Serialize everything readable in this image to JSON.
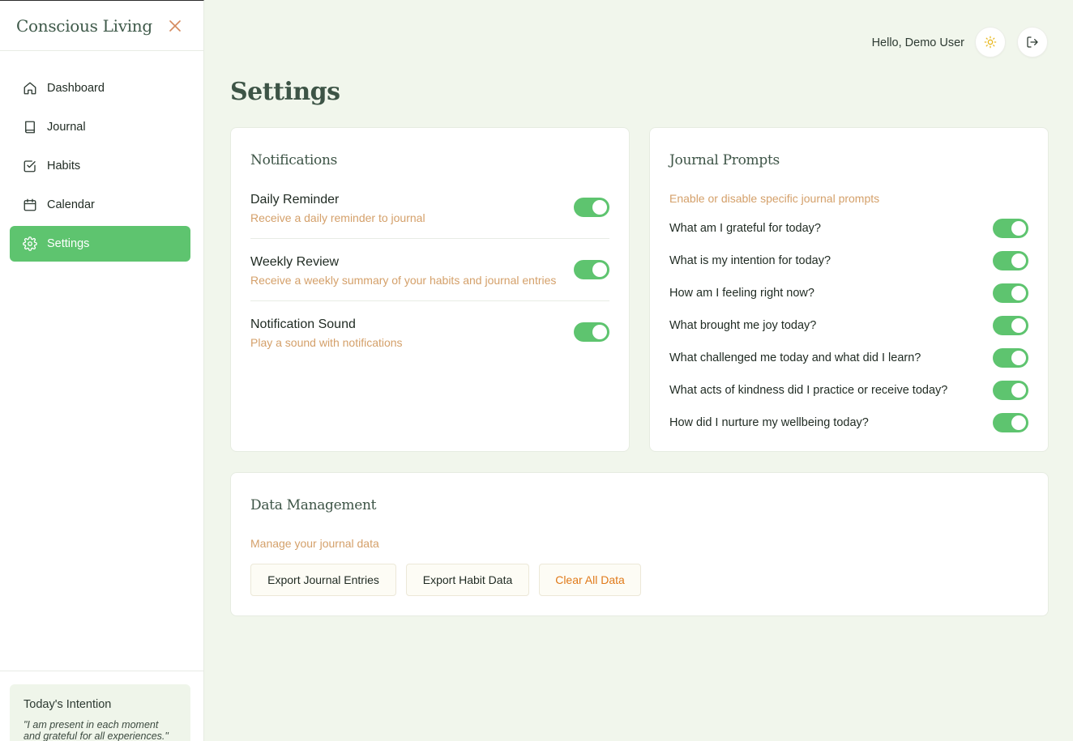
{
  "sidebar": {
    "brand": "Conscious Living",
    "close_icon": "close-icon",
    "items": [
      {
        "label": "Dashboard",
        "icon": "home-icon",
        "active": false
      },
      {
        "label": "Journal",
        "icon": "book-icon",
        "active": false
      },
      {
        "label": "Habits",
        "icon": "checkbox-icon",
        "active": false
      },
      {
        "label": "Calendar",
        "icon": "calendar-icon",
        "active": false
      },
      {
        "label": "Settings",
        "icon": "gear-icon",
        "active": true
      }
    ],
    "intention": {
      "title": "Today's Intention",
      "text": "\"I am present in each moment and grateful for all experiences.\""
    }
  },
  "header": {
    "greeting": "Hello, Demo User",
    "theme_icon": "sun-icon",
    "logout_icon": "logout-icon"
  },
  "page": {
    "title": "Settings"
  },
  "notifications": {
    "title": "Notifications",
    "items": [
      {
        "label": "Daily Reminder",
        "description": "Receive a daily reminder to journal",
        "enabled": true
      },
      {
        "label": "Weekly Review",
        "description": "Receive a weekly summary of your habits and journal entries",
        "enabled": true
      },
      {
        "label": "Notification Sound",
        "description": "Play a sound with notifications",
        "enabled": true
      }
    ]
  },
  "journal_prompts": {
    "title": "Journal Prompts",
    "subtitle": "Enable or disable specific journal prompts",
    "items": [
      {
        "label": "What am I grateful for today?",
        "enabled": true
      },
      {
        "label": "What is my intention for today?",
        "enabled": true
      },
      {
        "label": "How am I feeling right now?",
        "enabled": true
      },
      {
        "label": "What brought me joy today?",
        "enabled": true
      },
      {
        "label": "What challenged me today and what did I learn?",
        "enabled": true
      },
      {
        "label": "What acts of kindness did I practice or receive today?",
        "enabled": true
      },
      {
        "label": "How did I nurture my wellbeing today?",
        "enabled": true
      }
    ]
  },
  "data_management": {
    "title": "Data Management",
    "subtitle": "Manage your journal data",
    "buttons": {
      "export_journal": "Export Journal Entries",
      "export_habit": "Export Habit Data",
      "clear_all": "Clear All Data"
    }
  },
  "colors": {
    "accent": "#5ec46f",
    "muted_orange": "#d4a06a",
    "danger": "#e07a1a",
    "background": "#f1f6ec"
  }
}
